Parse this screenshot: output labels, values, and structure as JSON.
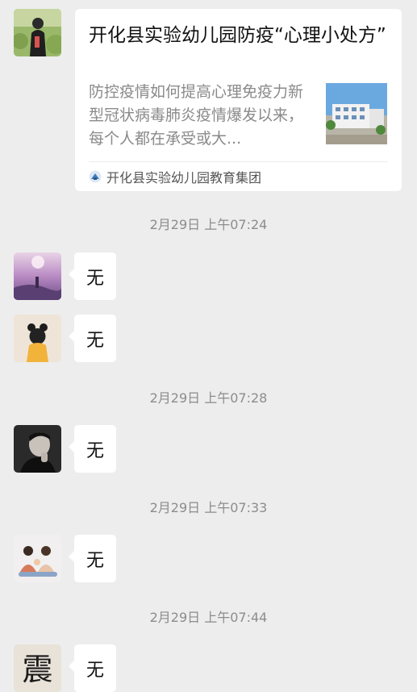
{
  "article": {
    "title": "开化县实验幼儿园防疫“心理小处方”",
    "description": "防控疫情如何提高心理免疫力新型冠状病毒肺炎疫情爆发以来，每个人都在承受或大...",
    "source": "开化县实验幼儿园教育集团"
  },
  "messages": [
    {
      "timestamp": "2月29日 上午07:24",
      "text": "无"
    },
    {
      "timestamp": "",
      "text": "无"
    },
    {
      "timestamp": "2月29日 上午07:28",
      "text": "无"
    },
    {
      "timestamp": "2月29日 上午07:33",
      "text": "无"
    },
    {
      "timestamp": "2月29日 上午07:44",
      "text": "无"
    }
  ],
  "avatar_seal_char": "震"
}
